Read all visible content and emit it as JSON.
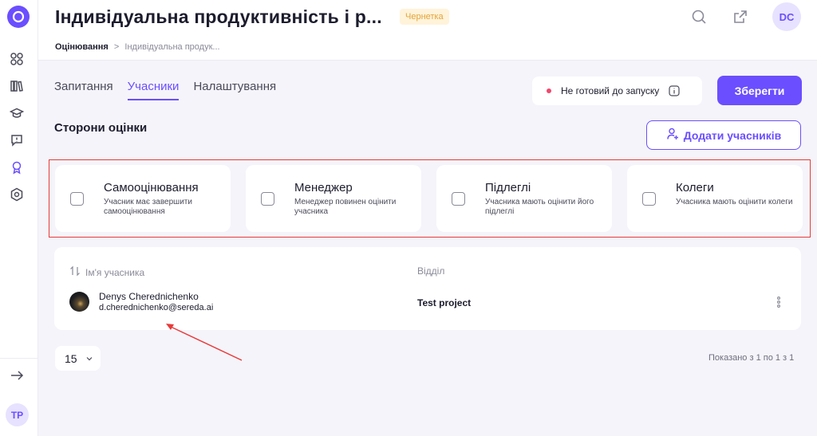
{
  "app": {
    "title": "Індивідуальна продуктивність і р...",
    "status_badge": "Чернетка",
    "user_initials": "DC",
    "sidebar_user_initials": "TP"
  },
  "breadcrumb": {
    "root": "Оцінювання",
    "separator": ">",
    "current": "Індивідуальна продук..."
  },
  "tabs": [
    {
      "label": "Запитання",
      "active": false
    },
    {
      "label": "Учасники",
      "active": true
    },
    {
      "label": "Налаштування",
      "active": false
    }
  ],
  "launch_status": {
    "text": "Не готовий до запуску"
  },
  "save_label": "Зберегти",
  "section": {
    "title": "Сторони оцінки",
    "add_label": "Додати учасників"
  },
  "parties": [
    {
      "title": "Самооцінювання",
      "description": "Учасник має завершити самооцінювання",
      "checked": false
    },
    {
      "title": "Менеджер",
      "description": "Менеджер повинен оцінити учасника",
      "checked": false
    },
    {
      "title": "Підлеглі",
      "description": "Учасника мають оцінити його підлеглі",
      "checked": false
    },
    {
      "title": "Колеги",
      "description": "Учасника мають оцінити колеги",
      "checked": false
    }
  ],
  "table": {
    "columns": [
      "Ім'я учасника",
      "Відділ"
    ],
    "rows": [
      {
        "name": "Denys Cherednichenko",
        "email": "d.cherednichenko@sereda.ai",
        "department": "Test project"
      }
    ]
  },
  "pagination": {
    "page_size": "15",
    "shown_text": "Показано з 1 по 1 з 1"
  },
  "colors": {
    "accent": "#6b4eff",
    "highlight_box": "#e83a3a",
    "status_dot": "#f0476b",
    "draft_badge_bg": "#fff3da"
  },
  "icons": [
    "logo-icon",
    "dashboard-icon",
    "library-icon",
    "graduation-cap-icon",
    "feedback-icon",
    "award-icon",
    "settings-icon",
    "expand-arrow-icon",
    "search-icon",
    "external-link-icon",
    "info-icon",
    "add-user-icon",
    "sort-icon",
    "chevron-down-icon",
    "more-vertical-icon"
  ]
}
